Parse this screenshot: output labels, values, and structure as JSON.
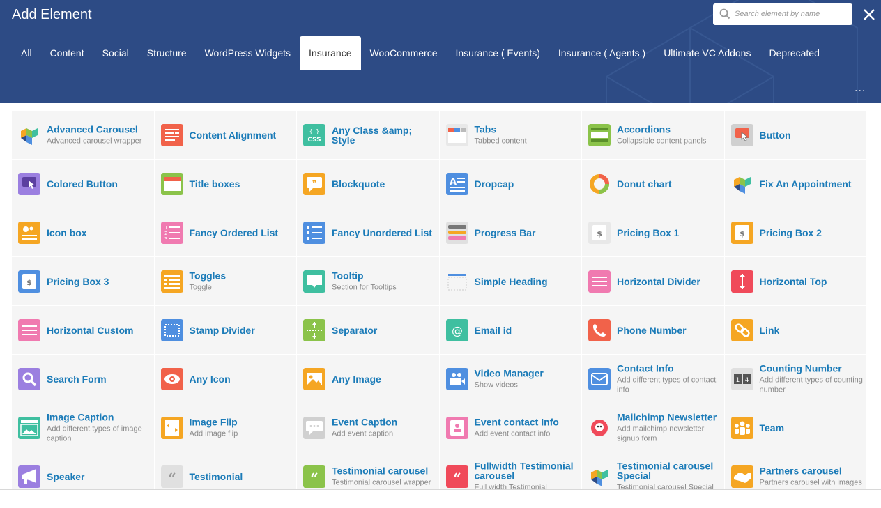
{
  "dialog": {
    "title": "Add Element"
  },
  "search": {
    "placeholder": "Search element by name"
  },
  "tabs": [
    {
      "label": "All"
    },
    {
      "label": "Content"
    },
    {
      "label": "Social"
    },
    {
      "label": "Structure"
    },
    {
      "label": "WordPress Widgets"
    },
    {
      "label": "Insurance"
    },
    {
      "label": "WooCommerce"
    },
    {
      "label": "Insurance ( Events)"
    },
    {
      "label": "Insurance ( Agents )"
    },
    {
      "label": "Ultimate VC Addons"
    },
    {
      "label": "Deprecated"
    }
  ],
  "active_tab": "Insurance",
  "more_label": "...",
  "colors": {
    "header": "#2d4b85",
    "link": "#1b7bb8",
    "tile": "#f5f5f5"
  },
  "elements": [
    {
      "name": "Advanced Carousel",
      "desc": "Advanced carousel wrapper",
      "icon": "vc-logo-icon",
      "color": "#ffffff"
    },
    {
      "name": "Content Alignment",
      "desc": "",
      "icon": "content-alignment-icon",
      "color": "#f1624a"
    },
    {
      "name": "Any Class &amp; Style",
      "desc": "",
      "icon": "css-icon",
      "color": "#3fbfa0"
    },
    {
      "name": "Tabs",
      "desc": "Tabbed content",
      "icon": "tabs-icon",
      "color": "#e8e8e8"
    },
    {
      "name": "Accordions",
      "desc": "Collapsible content panels",
      "icon": "accordion-icon",
      "color": "#8bc34a"
    },
    {
      "name": "Button",
      "desc": "",
      "icon": "button-icon",
      "color": "#d0d0d0"
    },
    {
      "name": "Colored Button",
      "desc": "",
      "icon": "colored-button-icon",
      "color": "#9b7fe0"
    },
    {
      "name": "Title boxes",
      "desc": "",
      "icon": "title-box-icon",
      "color": "#8bc34a"
    },
    {
      "name": "Blockquote",
      "desc": "",
      "icon": "blockquote-icon",
      "color": "#f5a623"
    },
    {
      "name": "Dropcap",
      "desc": "",
      "icon": "dropcap-icon",
      "color": "#4f8fe0"
    },
    {
      "name": "Donut chart",
      "desc": "",
      "icon": "donut-chart-icon",
      "color": "#ffffff"
    },
    {
      "name": "Fix An Appointment",
      "desc": "",
      "icon": "vc-logo-icon",
      "color": "#ffffff"
    },
    {
      "name": "Icon box",
      "desc": "",
      "icon": "icon-box-icon",
      "color": "#f5a623"
    },
    {
      "name": "Fancy Ordered List",
      "desc": "",
      "icon": "ordered-list-icon",
      "color": "#f07ab0"
    },
    {
      "name": "Fancy Unordered List",
      "desc": "",
      "icon": "unordered-list-icon",
      "color": "#4f8fe0"
    },
    {
      "name": "Progress Bar",
      "desc": "",
      "icon": "progress-bar-icon",
      "color": "#e0e0e0"
    },
    {
      "name": "Pricing Box 1",
      "desc": "",
      "icon": "pricing-box-icon",
      "color": "#e8e8e8"
    },
    {
      "name": "Pricing Box 2",
      "desc": "",
      "icon": "pricing-box-icon",
      "color": "#f5a623"
    },
    {
      "name": "Pricing Box 3",
      "desc": "",
      "icon": "pricing-box-icon",
      "color": "#4f8fe0"
    },
    {
      "name": "Toggles",
      "desc": "Toggle",
      "icon": "toggles-icon",
      "color": "#f5a623"
    },
    {
      "name": "Tooltip",
      "desc": "Section for Tooltips",
      "icon": "tooltip-icon",
      "color": "#3fbfa0"
    },
    {
      "name": "Simple Heading",
      "desc": "",
      "icon": "heading-icon",
      "color": "#ffffff"
    },
    {
      "name": "Horizontal Divider",
      "desc": "",
      "icon": "divider-icon",
      "color": "#f07ab0"
    },
    {
      "name": "Horizontal Top",
      "desc": "",
      "icon": "arrow-updown-icon",
      "color": "#f04a5a"
    },
    {
      "name": "Horizontal Custom",
      "desc": "",
      "icon": "divider-icon",
      "color": "#f07ab0"
    },
    {
      "name": "Stamp Divider",
      "desc": "",
      "icon": "stamp-divider-icon",
      "color": "#4f8fe0"
    },
    {
      "name": "Separator",
      "desc": "",
      "icon": "separator-icon",
      "color": "#8bc34a"
    },
    {
      "name": "Email id",
      "desc": "",
      "icon": "at-sign-icon",
      "color": "#3fbfa0"
    },
    {
      "name": "Phone Number",
      "desc": "",
      "icon": "phone-icon",
      "color": "#f1624a"
    },
    {
      "name": "Link",
      "desc": "",
      "icon": "link-icon",
      "color": "#f5a623"
    },
    {
      "name": "Search Form",
      "desc": "",
      "icon": "search-icon",
      "color": "#9b7fe0"
    },
    {
      "name": "Any Icon",
      "desc": "",
      "icon": "eye-icon",
      "color": "#f1624a"
    },
    {
      "name": "Any Image",
      "desc": "",
      "icon": "image-icon",
      "color": "#f5a623"
    },
    {
      "name": "Video Manager",
      "desc": "Show videos",
      "icon": "video-camera-icon",
      "color": "#4f8fe0"
    },
    {
      "name": "Contact Info",
      "desc": "Add different types of contact info",
      "icon": "envelope-icon",
      "color": "#4f8fe0"
    },
    {
      "name": "Counting Number",
      "desc": "Add different types of counting number",
      "icon": "counter-icon",
      "color": "#e0e0e0"
    },
    {
      "name": "Image Caption",
      "desc": "Add different types of image caption",
      "icon": "image-caption-icon",
      "color": "#3fbfa0"
    },
    {
      "name": "Image Flip",
      "desc": "Add image flip",
      "icon": "image-flip-icon",
      "color": "#f5a623"
    },
    {
      "name": "Event Caption",
      "desc": "Add event caption",
      "icon": "speech-bubble-icon",
      "color": "#d0d0d0"
    },
    {
      "name": "Event contact Info",
      "desc": "Add event contact info",
      "icon": "contact-card-icon",
      "color": "#f07ab0"
    },
    {
      "name": "Mailchimp Newsletter",
      "desc": "Add mailchimp newsletter signup form",
      "icon": "mailchimp-icon",
      "color": "#ffffff"
    },
    {
      "name": "Team",
      "desc": "",
      "icon": "team-icon",
      "color": "#f5a623"
    },
    {
      "name": "Speaker",
      "desc": "",
      "icon": "megaphone-icon",
      "color": "#9b7fe0"
    },
    {
      "name": "Testimonial",
      "desc": "",
      "icon": "quote-icon",
      "color": "#e0e0e0"
    },
    {
      "name": "Testimonial carousel",
      "desc": "Testimonial carousel wrapper",
      "icon": "quote-icon",
      "color": "#8bc34a"
    },
    {
      "name": "Fullwidth Testimonial carousel",
      "desc": "Full width Testimonial",
      "icon": "quote-icon",
      "color": "#f04a5a"
    },
    {
      "name": "Testimonial carousel Special",
      "desc": "Testimonial carousel Special",
      "icon": "vc-logo-icon",
      "color": "#ffffff"
    },
    {
      "name": "Partners carousel",
      "desc": "Partners carousel with images",
      "icon": "handshake-icon",
      "color": "#f5a623"
    }
  ]
}
